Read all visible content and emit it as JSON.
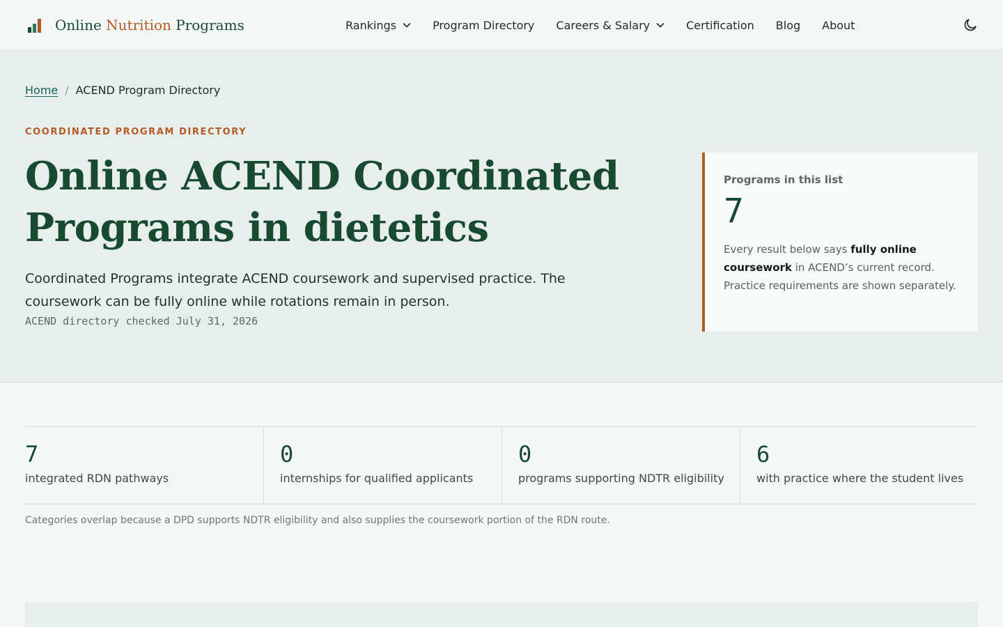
{
  "header": {
    "logo": {
      "word1": "Online",
      "word2": "Nutrition",
      "word3": "Programs",
      "icon": "bar-chart-logo-icon"
    },
    "nav": [
      {
        "label": "Rankings",
        "has_dropdown": true
      },
      {
        "label": "Program Directory",
        "has_dropdown": false
      },
      {
        "label": "Careers & Salary",
        "has_dropdown": true
      },
      {
        "label": "Certification",
        "has_dropdown": false
      },
      {
        "label": "Blog",
        "has_dropdown": false
      },
      {
        "label": "About",
        "has_dropdown": false
      }
    ],
    "theme_toggle_icon": "moon-icon"
  },
  "breadcrumb": {
    "home": "Home",
    "separator": "/",
    "current": "ACEND Program Directory"
  },
  "hero": {
    "eyebrow": "COORDINATED PROGRAM DIRECTORY",
    "title": "Online ACEND Coordinated Programs in dietetics",
    "lede": "Coordinated Programs integrate ACEND coursework and supervised practice. The coursework can be fully online while rotations remain in person.",
    "checked": "ACEND directory checked July 31, 2026"
  },
  "count_card": {
    "label": "Programs in this list",
    "value": "7",
    "note_before": "Every result below says ",
    "note_bold": "fully online coursework",
    "note_after": " in ACEND’s current record. Practice requirements are shown separately."
  },
  "stats": [
    {
      "value": "7",
      "label": "integrated RDN pathways"
    },
    {
      "value": "0",
      "label": "internships for qualified applicants"
    },
    {
      "value": "0",
      "label": "programs supporting NDTR eligibility"
    },
    {
      "value": "6",
      "label": "with practice where the student lives"
    }
  ],
  "stats_note": "Categories overlap because a DPD supports NDTR eligibility and also supplies the coursework portion of the RDN route.",
  "colors": {
    "brand_green": "#184a32",
    "accent_orange": "#b35a25",
    "link_teal": "#17625a",
    "hero_bg": "#e7eeec",
    "page_bg": "#f3f7f6"
  }
}
